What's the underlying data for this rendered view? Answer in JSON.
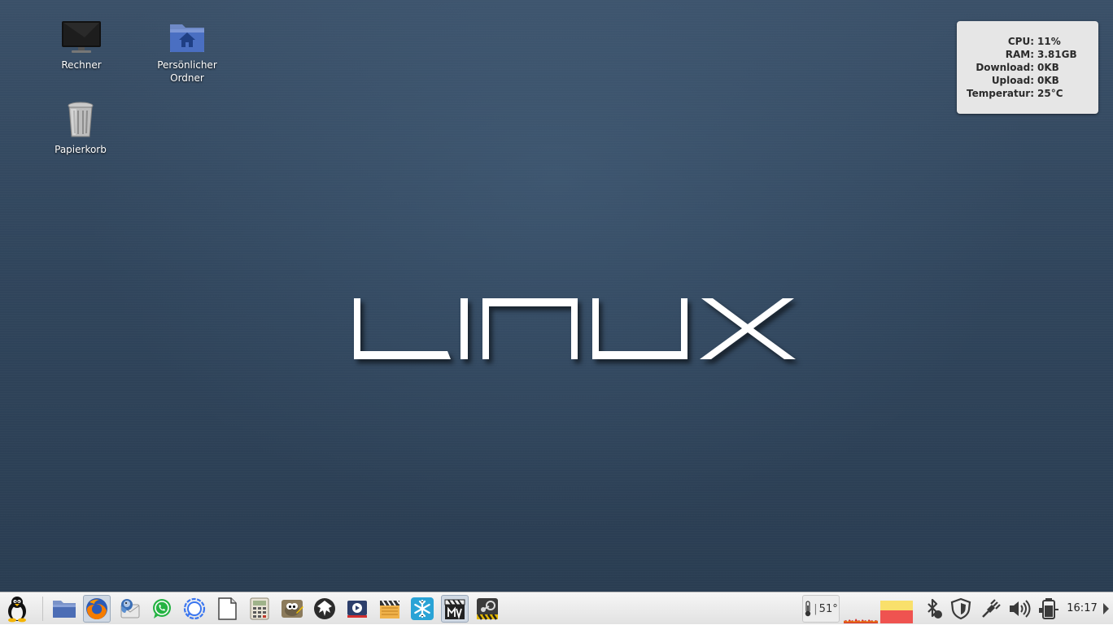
{
  "desktop": {
    "icons": [
      {
        "label": "Rechner",
        "icon": "monitor-icon"
      },
      {
        "label": "Persönlicher Ordner",
        "icon": "home-folder-icon"
      },
      {
        "label": "Papierkorb",
        "icon": "trash-icon"
      }
    ],
    "logo_text": "LINUX",
    "system_monitor": {
      "rows": [
        {
          "label": "CPU:",
          "value": "11%"
        },
        {
          "label": "RAM:",
          "value": "3.81GB"
        },
        {
          "label": "Download:",
          "value": "0KB"
        },
        {
          "label": "Upload:",
          "value": "0KB"
        },
        {
          "label": "Temperatur:",
          "value": "25°C"
        }
      ]
    }
  },
  "taskbar": {
    "launchers": [
      "tux-menu-icon",
      "file-manager-icon",
      "firefox-icon",
      "thunderbird-icon",
      "whatsapp-icon",
      "signal-icon",
      "blank-document-icon",
      "calculator-icon",
      "gimp-icon",
      "inkscape-icon",
      "video-player-icon",
      "clapperboard-icon",
      "snowflake-icon",
      "movie-editor-icon",
      "steam-icon"
    ],
    "temperature_indicator": "51°",
    "tray_icons": [
      "bluetooth-icon",
      "shield-icon",
      "network-plug-icon",
      "volume-icon",
      "battery-icon"
    ],
    "clock": "16:17",
    "colors": {
      "cpu_graph": "#d32f2f",
      "mem_top": "#f9e06b",
      "mem_bottom": "#ef5350"
    }
  }
}
